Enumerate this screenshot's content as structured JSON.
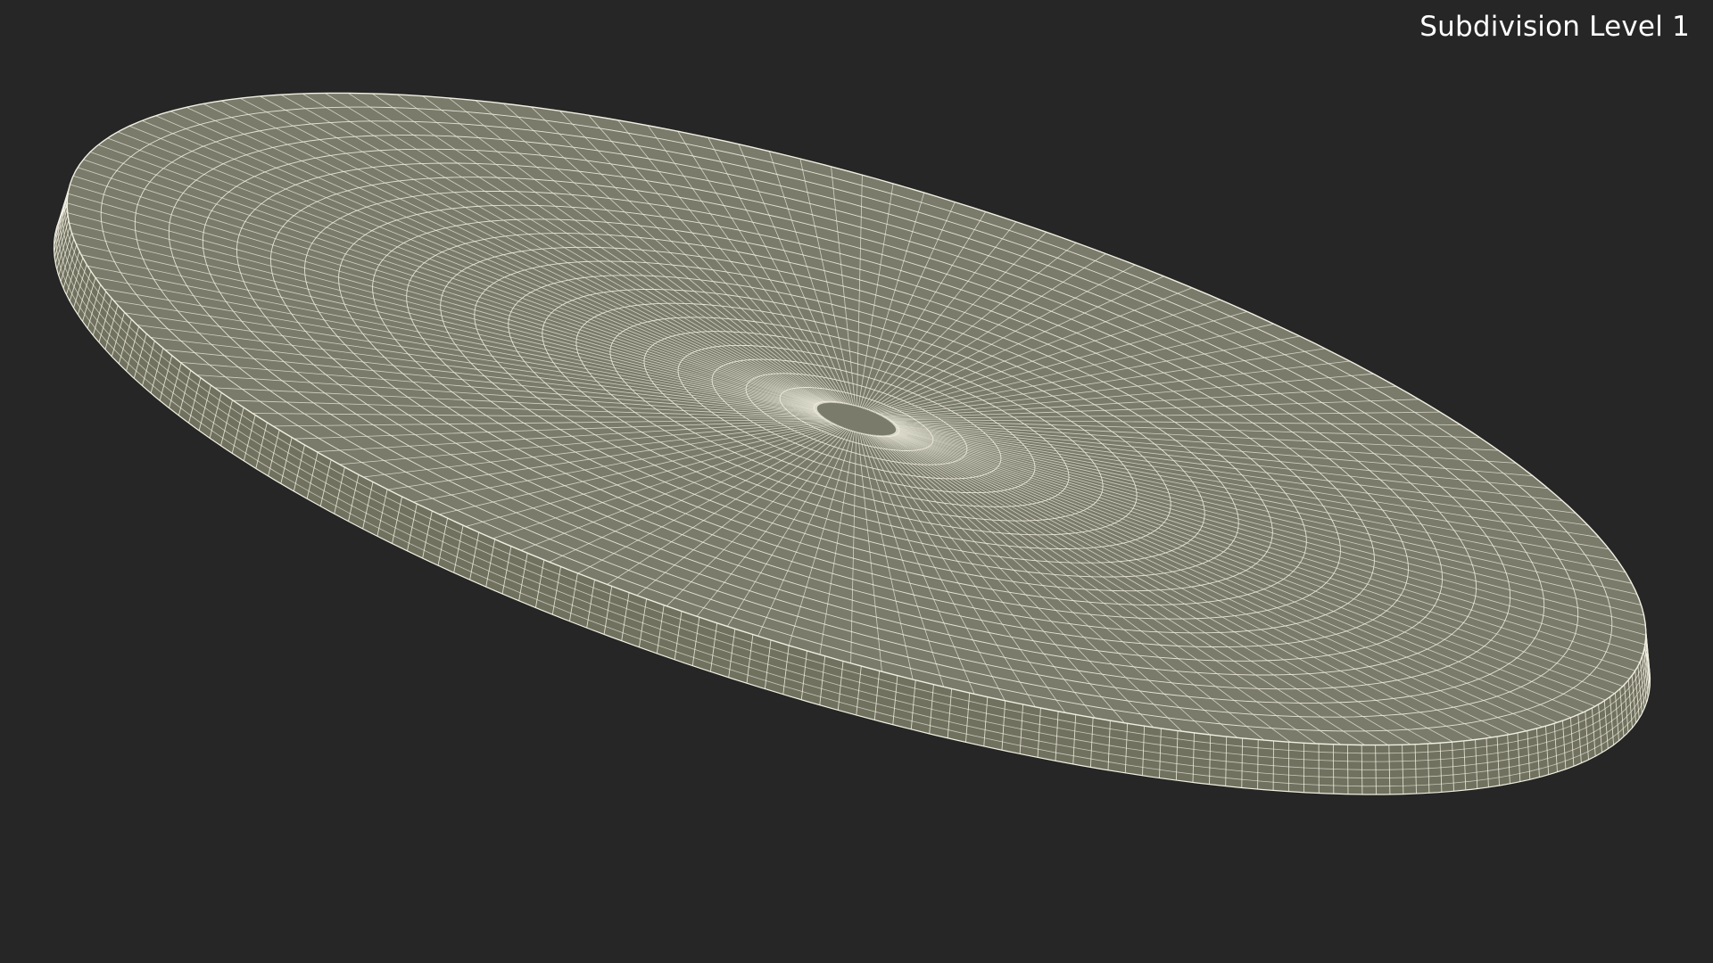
{
  "viewport": {
    "label": "Subdivision Level 1",
    "background_color": "#262626",
    "label_color": "#ffffff"
  },
  "model": {
    "shape": "flat oval disc (cushion) with rounded edge",
    "render_style": "wireframe over shaded",
    "surface_color": "#7a7b6b",
    "side_shade_color": "#70715f",
    "wire_color": "#f2f0e2"
  }
}
